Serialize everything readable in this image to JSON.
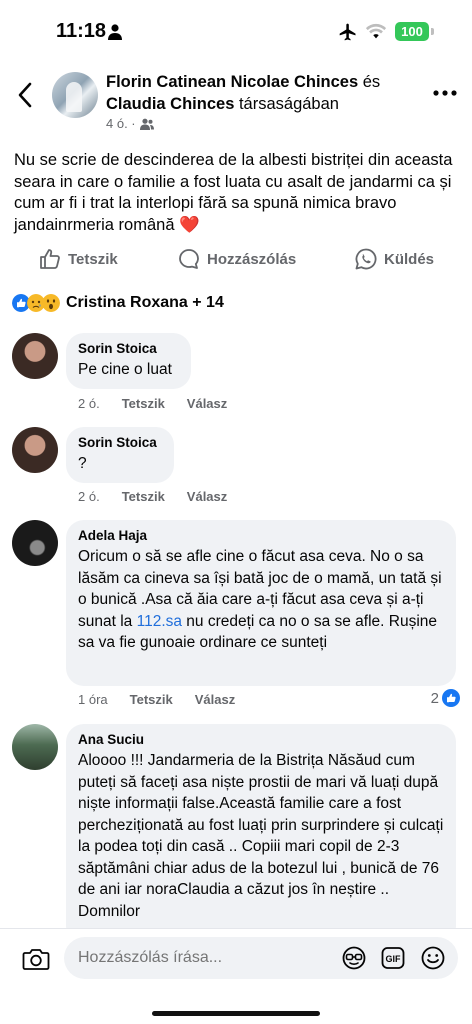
{
  "status": {
    "time": "11:18",
    "battery": "100"
  },
  "header": {
    "name1": "Florin Catinean Nicolae Chinces",
    "connector": " és ",
    "name2": "Claudia Chinces",
    "suffix": " társaságában",
    "time": "4 ó. ·",
    "privacy_icon": "friends-icon"
  },
  "post": {
    "text": "Nu se scrie de descinderea de la albesti bistriței din aceasta seara in care o familie a fost luata cu asalt de jandarmi ca și cum ar fi i trat la interlopi fără sa spună nimica  bravo jandainrmeria română ❤️"
  },
  "actions": {
    "like": "Tetszik",
    "comment": "Hozzászólás",
    "send": "Küldés"
  },
  "reactions": {
    "names": "Cristina Roxana + 14",
    "types": [
      "like",
      "sad",
      "wow"
    ]
  },
  "comments": [
    {
      "author": "Sorin Stoica",
      "text": "Pe cine o luat",
      "time": "2 ó.",
      "like": "Tetszik",
      "reply": "Válasz"
    },
    {
      "author": "Sorin Stoica",
      "text": "?",
      "time": "2 ó.",
      "like": "Tetszik",
      "reply": "Válasz"
    },
    {
      "author": "Adela Haja",
      "text_before": "Oricum o să se afle cine o făcut asa ceva. No o sa lăsăm ca cineva sa își  bată  joc  de o mamă, un tată și  o bunică .Asa că ăia care a-ți făcut asa ceva și a-ți sunat la ",
      "link": "112.sa",
      "text_after": " nu credeți ca no o sa se afle. Rușine sa va fie gunoaie ordinare ce sunteți",
      "time": "1 óra",
      "like": "Tetszik",
      "reply": "Válasz",
      "likes": "2"
    },
    {
      "author": "Ana Suciu",
      "text": "Aloooo !!! Jandarmeria de la Bistrița Năsăud cum puteți să faceți asa niște prostii de mari vă luați după niște informații false.Această familie care a fost percheziționată au fost luați prin surprindere și culcați la podea toți din casă .. Copiii mari copil de 2-3 săptămâni chiar adus de la botezul lui , bunică de 76 de ani iar noraClaudia a căzut jos în neștire .. Domnilor"
    }
  ],
  "composer": {
    "placeholder": "Hozzászólás írása..."
  },
  "colors": {
    "accent": "#216fdb",
    "battery": "#34c759",
    "bubble": "#f0f2f5",
    "muted": "#65676b"
  }
}
